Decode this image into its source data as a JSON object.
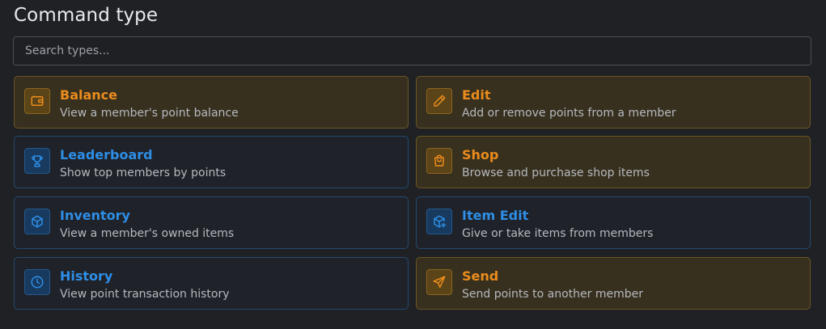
{
  "header": {
    "title": "Command type"
  },
  "search": {
    "placeholder": "Search types..."
  },
  "colors": {
    "orange_accent": "#eb8c1c",
    "blue_accent": "#2e8ee6",
    "background": "#1f2125"
  },
  "commands": [
    {
      "title": "Balance",
      "description": "View a member's point balance",
      "icon": "wallet-icon",
      "accent": "orange"
    },
    {
      "title": "Edit",
      "description": "Add or remove points from a member",
      "icon": "pencil-icon",
      "accent": "orange"
    },
    {
      "title": "Leaderboard",
      "description": "Show top members by points",
      "icon": "trophy-icon",
      "accent": "blue"
    },
    {
      "title": "Shop",
      "description": "Browse and purchase shop items",
      "icon": "shopping-bag-icon",
      "accent": "orange"
    },
    {
      "title": "Inventory",
      "description": "View a member's owned items",
      "icon": "box-icon",
      "accent": "blue"
    },
    {
      "title": "Item Edit",
      "description": "Give or take items from members",
      "icon": "box-plus-icon",
      "accent": "blue"
    },
    {
      "title": "History",
      "description": "View point transaction history",
      "icon": "clock-icon",
      "accent": "blue"
    },
    {
      "title": "Send",
      "description": "Send points to another member",
      "icon": "send-icon",
      "accent": "orange"
    }
  ]
}
